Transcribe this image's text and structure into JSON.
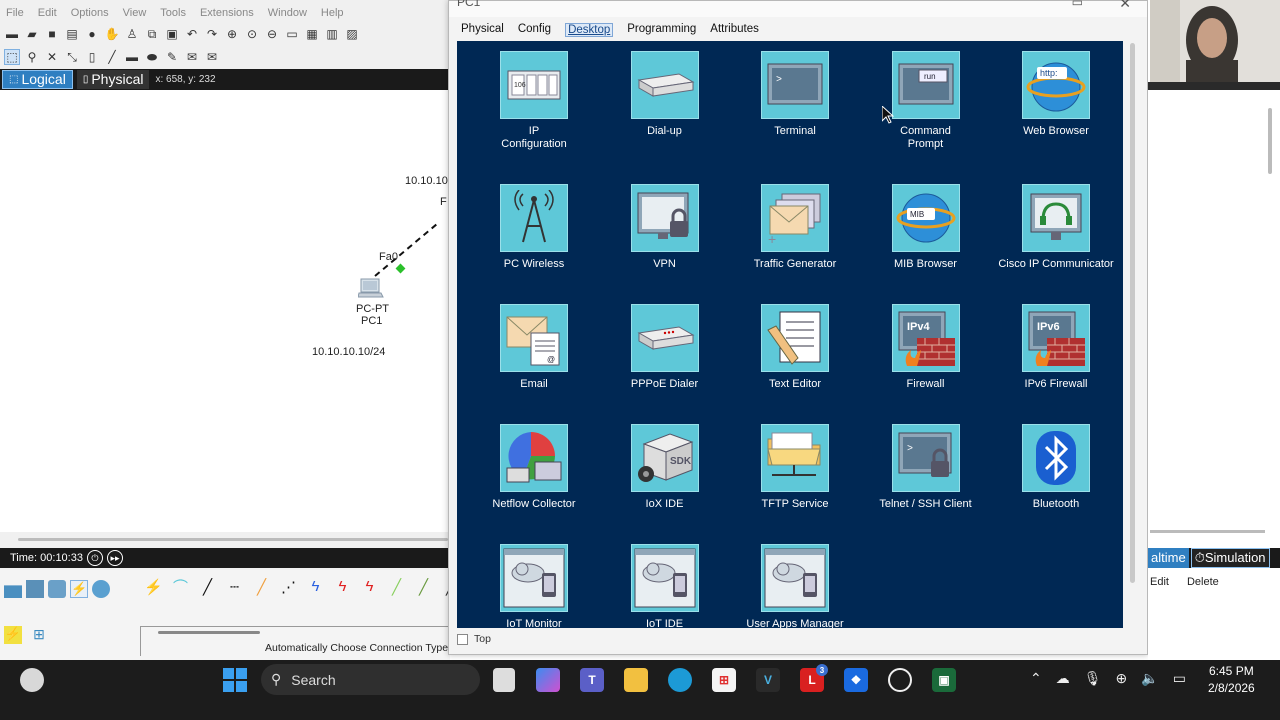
{
  "menu": [
    "File",
    "Edit",
    "Options",
    "View",
    "Tools",
    "Extensions",
    "Window",
    "Help"
  ],
  "view_tabs": {
    "logical": "Logical",
    "physical": "Physical",
    "coords": "x: 658, y: 232"
  },
  "canvas": {
    "ip_top": "10.10.10",
    "port_partial": "F",
    "port": "Fa0",
    "pc_type": "PC-PT",
    "pc_name": "PC1",
    "pc_ip": "10.10.10.10/24"
  },
  "timebar": {
    "time": "Time: 00:10:33"
  },
  "device_panel": {
    "auto_connection": "Automatically Choose Connection Type"
  },
  "pc_window": {
    "title": "PC1",
    "tabs": [
      {
        "label": "Physical",
        "active": false
      },
      {
        "label": "Config",
        "active": false
      },
      {
        "label": "Desktop",
        "active": true
      },
      {
        "label": "Programming",
        "active": false
      },
      {
        "label": "Attributes",
        "active": false
      }
    ],
    "apps": [
      {
        "label": "IP\nConfiguration",
        "icon": "ip-config-icon"
      },
      {
        "label": "Dial-up",
        "icon": "modem-icon"
      },
      {
        "label": "Terminal",
        "icon": "terminal-icon"
      },
      {
        "label": "Command\nPrompt",
        "icon": "command-prompt-icon"
      },
      {
        "label": "Web Browser",
        "icon": "web-browser-icon"
      },
      {
        "label": "PC Wireless",
        "icon": "antenna-icon"
      },
      {
        "label": "VPN",
        "icon": "vpn-lock-icon"
      },
      {
        "label": "Traffic Generator",
        "icon": "envelope-stack-icon"
      },
      {
        "label": "MIB Browser",
        "icon": "mib-globe-icon"
      },
      {
        "label": "Cisco IP Communicator",
        "icon": "headset-monitor-icon"
      },
      {
        "label": "Email",
        "icon": "email-icon"
      },
      {
        "label": "PPPoE Dialer",
        "icon": "pppoe-modem-icon"
      },
      {
        "label": "Text Editor",
        "icon": "text-editor-icon"
      },
      {
        "label": "Firewall",
        "icon": "ipv4-firewall-icon"
      },
      {
        "label": "IPv6 Firewall",
        "icon": "ipv6-firewall-icon"
      },
      {
        "label": "Netflow Collector",
        "icon": "netflow-chart-icon"
      },
      {
        "label": "IoX IDE",
        "icon": "sdk-box-icon"
      },
      {
        "label": "TFTP Service",
        "icon": "folder-icon"
      },
      {
        "label": "Telnet / SSH Client",
        "icon": "telnet-lock-icon"
      },
      {
        "label": "Bluetooth",
        "icon": "bluetooth-icon"
      },
      {
        "label": "IoT Monitor",
        "icon": "cloud-phone-icon"
      },
      {
        "label": "IoT IDE",
        "icon": "cloud-phone-icon"
      },
      {
        "label": "User Apps Manager",
        "icon": "cloud-phone-icon"
      }
    ],
    "icon_texts": {
      "ip": "106",
      "cmd": "run",
      "http": "http:",
      "ipv4": "IPv4",
      "ipv6": "IPv6",
      "sdk": "SDK",
      "mib": "MIB"
    },
    "top_checkbox": "Top"
  },
  "right_panel": {
    "realtime": "altime",
    "simulation": "Simulation",
    "edit": "Edit",
    "delete": "Delete"
  },
  "taskbar": {
    "search_placeholder": "Search",
    "time": "6:45 PM",
    "date": "2/8/2026",
    "notification_count": "3"
  },
  "colors": {
    "desktop_bg": "#002854",
    "icon_bg": "#5ec8d8",
    "accent": "#2f7fc1"
  }
}
